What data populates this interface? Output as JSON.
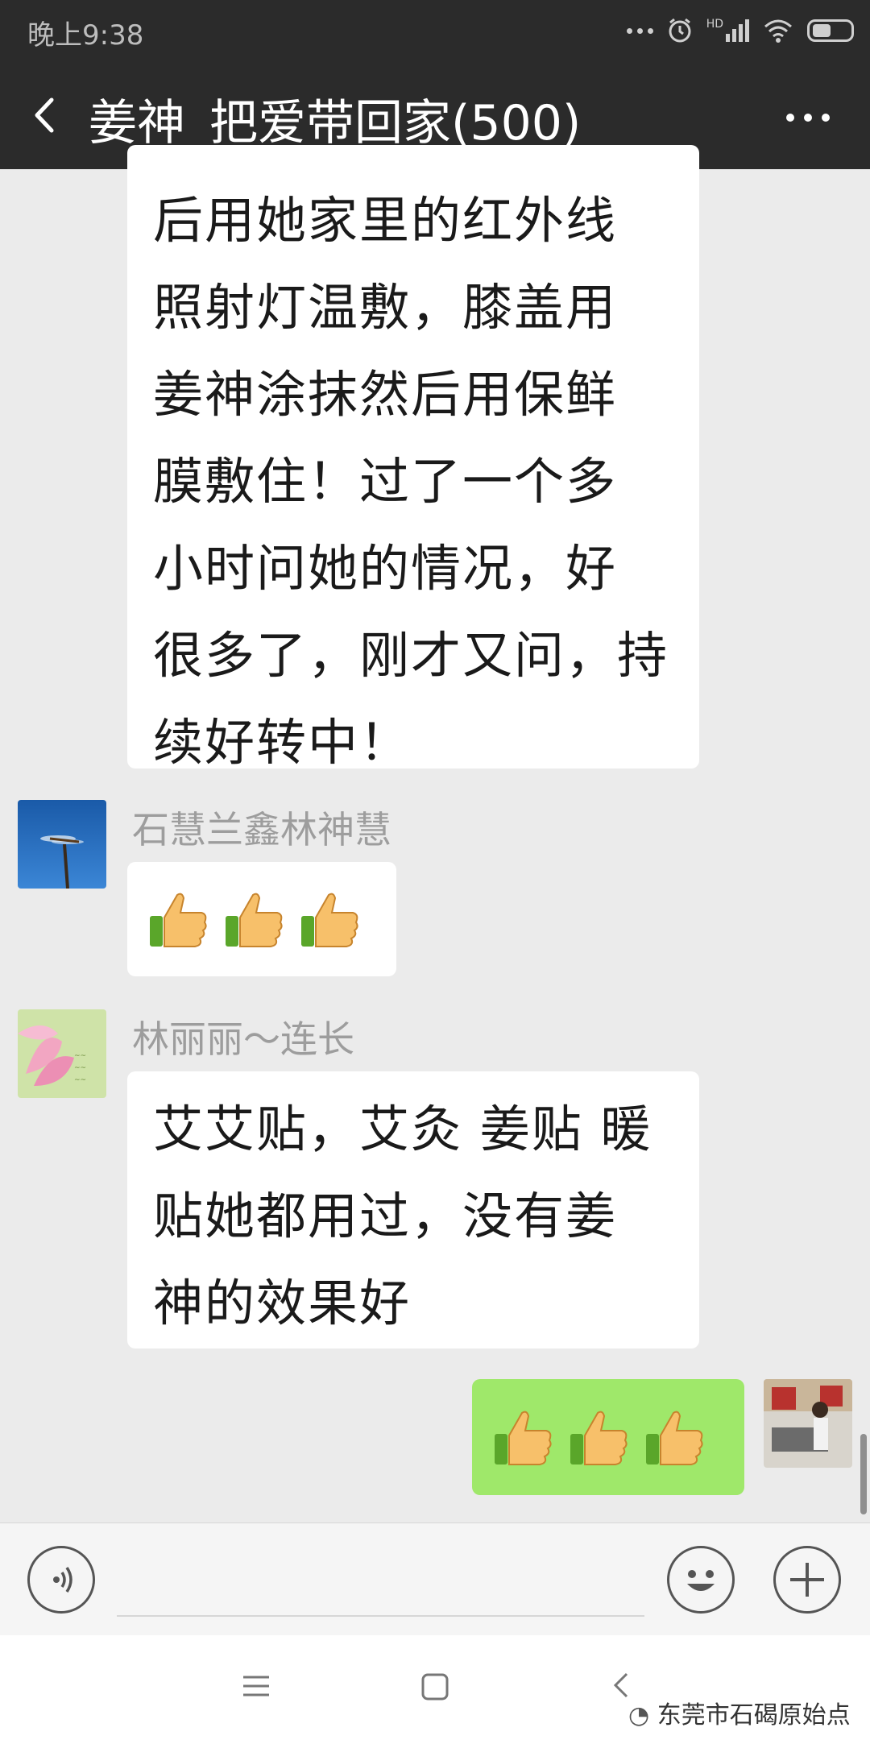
{
  "status_bar": {
    "time": "晚上9:38",
    "signal_label": "HD"
  },
  "header": {
    "title": "姜神_把爱带回家(500)"
  },
  "messages": [
    {
      "side": "left",
      "sender": "",
      "lines": [
        "后用她家里的红外线",
        "照射灯温敷，膝盖用",
        "姜神涂抹然后用保鲜",
        "膜敷住！过了一个多",
        "小时问她的情况，好",
        "很多了，刚才又问，持",
        "续好转中！"
      ]
    },
    {
      "side": "left",
      "sender": "石慧兰鑫林神慧",
      "emoji": [
        "thumbs-up",
        "thumbs-up",
        "thumbs-up"
      ]
    },
    {
      "side": "left",
      "sender": "林丽丽～连长",
      "lines": [
        "艾艾贴，艾灸 姜贴 暖",
        "贴她都用过，没有姜",
        "神的效果好"
      ]
    },
    {
      "side": "right",
      "sender": "",
      "emoji": [
        "thumbs-up",
        "thumbs-up",
        "thumbs-up"
      ]
    }
  ],
  "watermark": "东莞市石碣原始点",
  "colors": {
    "header_bg": "#2b2b2b",
    "chat_bg": "#ebebeb",
    "bubble_in": "#ffffff",
    "bubble_out": "#9fe86a"
  }
}
